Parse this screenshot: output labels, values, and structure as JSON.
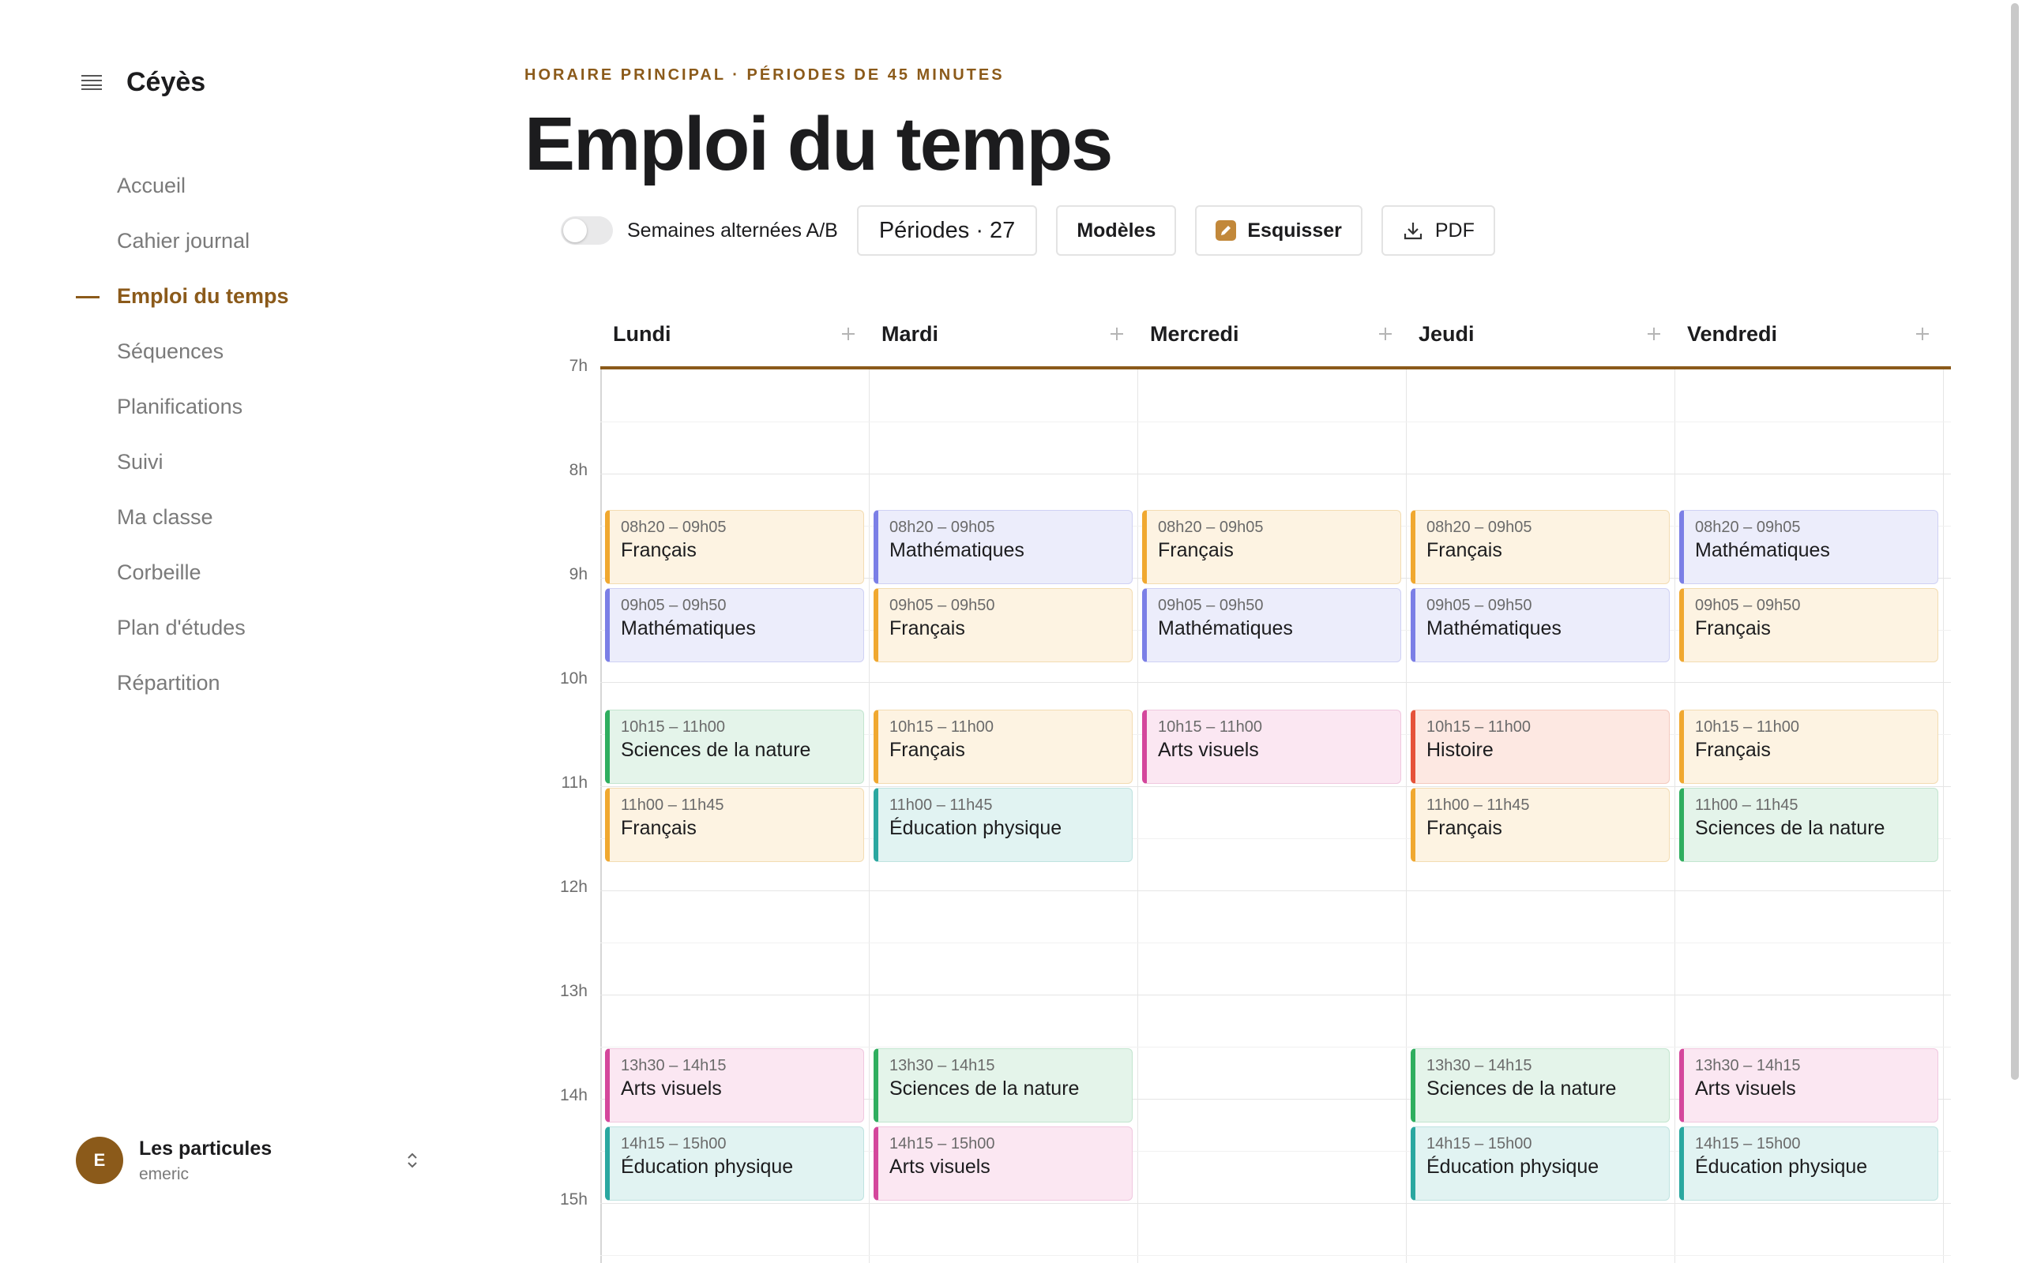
{
  "app": {
    "name": "Céyès"
  },
  "sidebar": {
    "items": [
      {
        "label": "Accueil",
        "active": false
      },
      {
        "label": "Cahier journal",
        "active": false
      },
      {
        "label": "Emploi du temps",
        "active": true
      },
      {
        "label": "Séquences",
        "active": false
      },
      {
        "label": "Planifications",
        "active": false
      },
      {
        "label": "Suivi",
        "active": false
      },
      {
        "label": "Ma classe",
        "active": false
      },
      {
        "label": "Corbeille",
        "active": false
      },
      {
        "label": "Plan d'études",
        "active": false
      },
      {
        "label": "Répartition",
        "active": false
      }
    ],
    "account": {
      "initial": "E",
      "name": "Les particules",
      "user": "emeric"
    }
  },
  "header": {
    "eyebrow": "HORAIRE PRINCIPAL · PÉRIODES DE 45 MINUTES",
    "title": "Emploi du temps"
  },
  "toolbar": {
    "toggle_label": "Semaines alternées A/B",
    "toggle_on": false,
    "periods_label": "Périodes · 27",
    "models_label": "Modèles",
    "sketch_label": "Esquisser",
    "pdf_label": "PDF"
  },
  "colors": {
    "accent": "#8b5a1a",
    "subjects": {
      "Français": {
        "bar": "#f0a830",
        "bg": "#fdf3e2",
        "border": "#f3dcb2"
      },
      "Mathématiques": {
        "bar": "#7b7fe6",
        "bg": "#ecedfb",
        "border": "#cfd1f4"
      },
      "Sciences de la nature": {
        "bar": "#2fae5f",
        "bg": "#e4f4ea",
        "border": "#c3e5cf"
      },
      "Arts visuels": {
        "bar": "#d4479c",
        "bg": "#fbe7f2",
        "border": "#f0c8df"
      },
      "Éducation physique": {
        "bar": "#2aa7a0",
        "bg": "#e1f3f2",
        "border": "#bfe3e0"
      },
      "Histoire": {
        "bar": "#e5523a",
        "bg": "#fde8e2",
        "border": "#f4c9be"
      }
    }
  },
  "schedule": {
    "hours": [
      "7h",
      "8h",
      "9h",
      "10h",
      "11h",
      "12h",
      "13h",
      "14h",
      "15h"
    ],
    "days": [
      {
        "name": "Lundi",
        "lessons": [
          {
            "time": "08h20 – 09h05",
            "subject": "Français"
          },
          {
            "time": "09h05 – 09h50",
            "subject": "Mathématiques"
          },
          {
            "time": "10h15 – 11h00",
            "subject": "Sciences de la nature"
          },
          {
            "time": "11h00 – 11h45",
            "subject": "Français"
          },
          {
            "time": "13h30 – 14h15",
            "subject": "Arts visuels"
          },
          {
            "time": "14h15 – 15h00",
            "subject": "Éducation physique"
          }
        ]
      },
      {
        "name": "Mardi",
        "lessons": [
          {
            "time": "08h20 – 09h05",
            "subject": "Mathématiques"
          },
          {
            "time": "09h05 – 09h50",
            "subject": "Français"
          },
          {
            "time": "10h15 – 11h00",
            "subject": "Français"
          },
          {
            "time": "11h00 – 11h45",
            "subject": "Éducation physique"
          },
          {
            "time": "13h30 – 14h15",
            "subject": "Sciences de la nature"
          },
          {
            "time": "14h15 – 15h00",
            "subject": "Arts visuels"
          }
        ]
      },
      {
        "name": "Mercredi",
        "lessons": [
          {
            "time": "08h20 – 09h05",
            "subject": "Français"
          },
          {
            "time": "09h05 – 09h50",
            "subject": "Mathématiques"
          },
          {
            "time": "10h15 – 11h00",
            "subject": "Arts visuels"
          }
        ]
      },
      {
        "name": "Jeudi",
        "lessons": [
          {
            "time": "08h20 – 09h05",
            "subject": "Français"
          },
          {
            "time": "09h05 – 09h50",
            "subject": "Mathématiques"
          },
          {
            "time": "10h15 – 11h00",
            "subject": "Histoire"
          },
          {
            "time": "11h00 – 11h45",
            "subject": "Français"
          },
          {
            "time": "13h30 – 14h15",
            "subject": "Sciences de la nature"
          },
          {
            "time": "14h15 – 15h00",
            "subject": "Éducation physique"
          }
        ]
      },
      {
        "name": "Vendredi",
        "lessons": [
          {
            "time": "08h20 – 09h05",
            "subject": "Mathématiques"
          },
          {
            "time": "09h05 – 09h50",
            "subject": "Français"
          },
          {
            "time": "10h15 – 11h00",
            "subject": "Français"
          },
          {
            "time": "11h00 – 11h45",
            "subject": "Sciences de la nature"
          },
          {
            "time": "13h30 – 14h15",
            "subject": "Arts visuels"
          },
          {
            "time": "14h15 – 15h00",
            "subject": "Éducation physique"
          }
        ]
      }
    ]
  }
}
